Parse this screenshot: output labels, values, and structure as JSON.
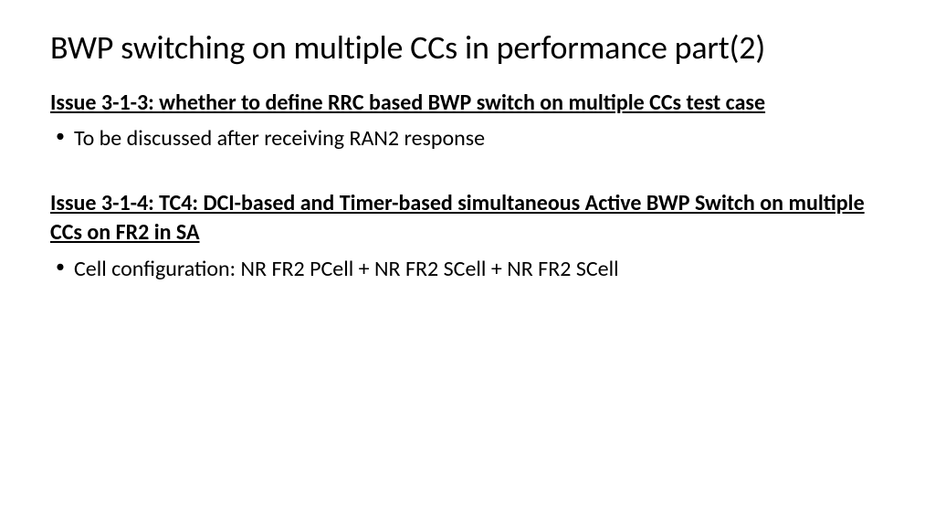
{
  "title": "BWP switching on multiple CCs in performance part(2)",
  "sections": [
    {
      "heading": "Issue 3-1-3: whether to define RRC based BWP switch on multiple CCs test case",
      "bullets": [
        "To be discussed after receiving RAN2 response"
      ]
    },
    {
      "heading": "Issue 3-1-4:  TC4: DCI-based and Timer-based simultaneous Active BWP Switch on multiple CCs on FR2 in SA",
      "bullets": [
        "Cell configuration: NR FR2 PCell + NR FR2 SCell + NR FR2 SCell"
      ]
    }
  ]
}
